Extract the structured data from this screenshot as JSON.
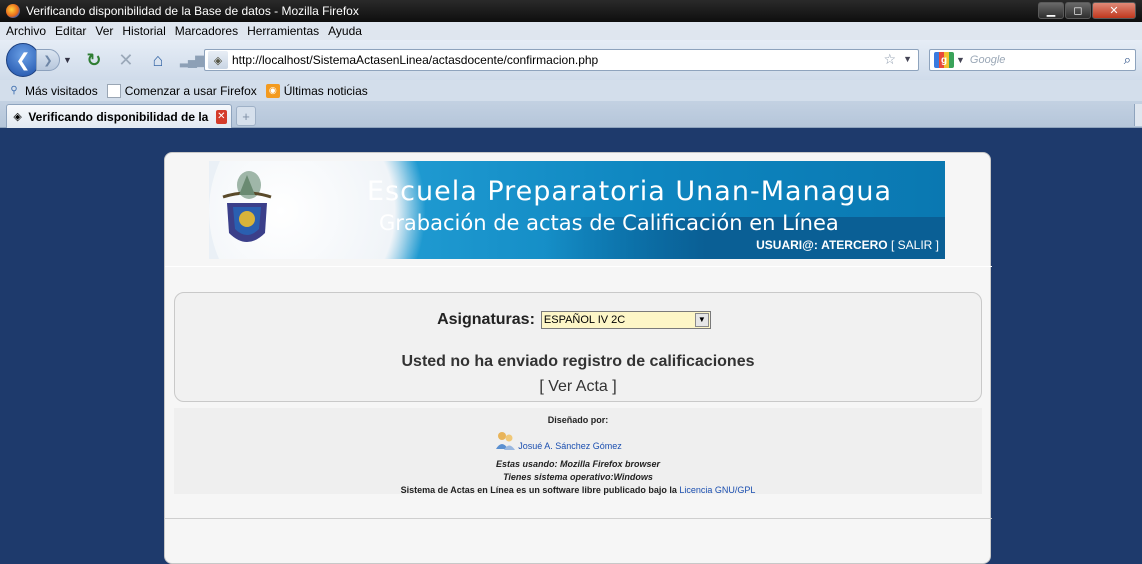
{
  "window": {
    "title": "Verificando disponibilidad de la Base de datos - Mozilla Firefox"
  },
  "menu": {
    "items": [
      "Archivo",
      "Editar",
      "Ver",
      "Historial",
      "Marcadores",
      "Herramientas",
      "Ayuda"
    ]
  },
  "navbar": {
    "url": "http://localhost/SistemaActasenLinea/actasdocente/confirmacion.php",
    "search_placeholder": "Google"
  },
  "bookmarks": {
    "items": [
      "Más visitados",
      "Comenzar a usar Firefox",
      "Últimas noticias"
    ]
  },
  "tabs": {
    "active_label": "Verificando disponibilidad de la Base ..."
  },
  "banner": {
    "title": "Escuela Preparatoria Unan-Managua",
    "subtitle": "Grabación de actas de Calificación en Línea",
    "user_label": "USUARI@:",
    "user_name": "ATERCERO",
    "logout_link": "[ SALIR ]"
  },
  "content": {
    "asignaturas_label": "Asignaturas:",
    "asignatura_selected": "ESPAÑOL IV 2C",
    "message": "Usted no ha enviado registro de calificaciones",
    "ver_acta_link": "[ Ver Acta ]"
  },
  "footer": {
    "designed_by": "Diseñado por:",
    "author": "Josué A. Sánchez Gómez",
    "browser": "Estas usando: Mozilla Firefox browser",
    "os": "Tienes sistema operativo:Windows",
    "license_text": "Sistema de Actas en Línea es un software libre publicado bajo la",
    "license_link": "Licencia GNU/GPL"
  },
  "colors": {
    "page_background": "#1e3a6c",
    "banner_blue": "#0e86c0",
    "link_blue": "#1b4fb0"
  }
}
